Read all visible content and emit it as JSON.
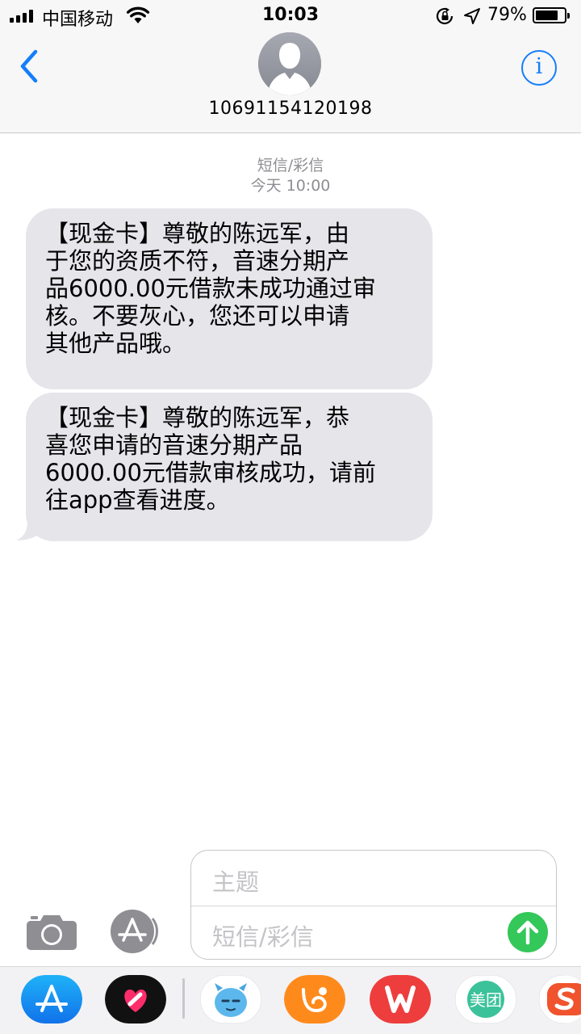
{
  "status_bar": {
    "carrier": "中国移动",
    "time": "10:03",
    "battery_percent": "79%",
    "battery_level": 0.79
  },
  "header": {
    "contact": "10691154120198",
    "back_icon": "chevron-left-icon",
    "info_icon": "info-icon",
    "info_glyph": "i"
  },
  "conversation": {
    "message_type": "短信/彩信",
    "timestamp": "今天 10:00",
    "messages": [
      {
        "lines": [
          "【现金卡】尊敬的陈远军，由",
          "于您的资质不符，音速分期产",
          "品6000.00元借款未成功通过审",
          "核。不要灰心，您还可以申请",
          "其他产品哦。"
        ]
      },
      {
        "lines": [
          "【现金卡】尊敬的陈远军，恭",
          "喜您申请的音速分期产品",
          "6000.00元借款审核成功，请前",
          "往app查看进度。"
        ]
      }
    ]
  },
  "compose": {
    "subject_placeholder": "主题",
    "message_placeholder": "短信/彩信"
  },
  "app_drawer": {
    "apps": [
      "app-store",
      "digital-touch",
      "monster-sticker",
      "uc-browser",
      "wps-office",
      "meituan",
      "sogou-input"
    ],
    "meituan_label": "美团"
  },
  "colors": {
    "accent": "#147efb",
    "bubble": "#e5e5ea",
    "send": "#34c759",
    "meta_text": "#8e8e93"
  }
}
